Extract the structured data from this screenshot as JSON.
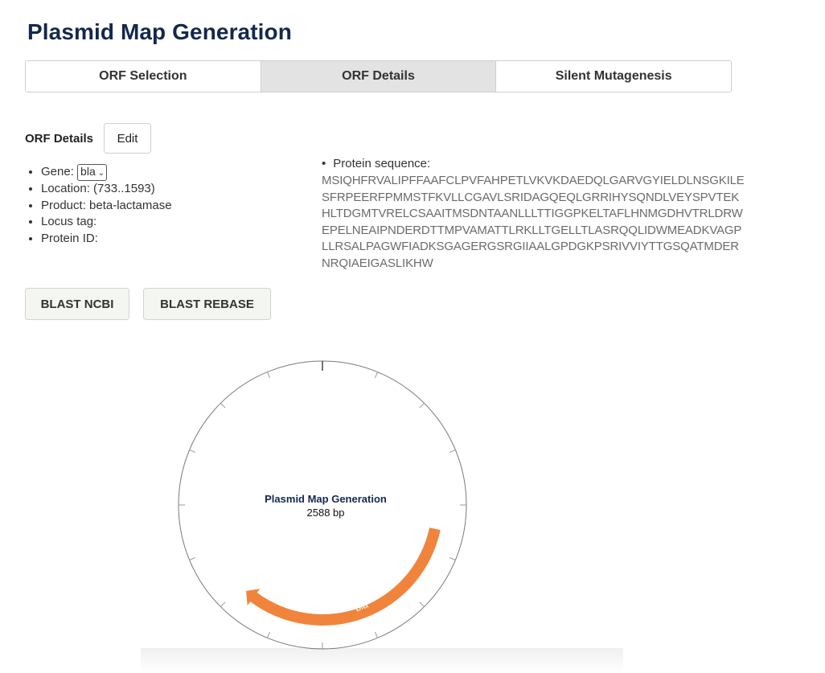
{
  "page": {
    "title": "Plasmid Map Generation"
  },
  "tabs": [
    {
      "label": "ORF Selection",
      "active": false
    },
    {
      "label": "ORF Details",
      "active": true
    },
    {
      "label": "Silent Mutagenesis",
      "active": false
    }
  ],
  "details": {
    "heading": "ORF Details",
    "edit_label": "Edit",
    "gene_label": "Gene:",
    "gene_value": "bla",
    "location": "Location: (733..1593)",
    "product": "Product: beta-lactamase",
    "locus_tag": "Locus tag:",
    "protein_id": "Protein ID:"
  },
  "protein": {
    "label": "Protein sequence:",
    "lines": [
      "MSIQHFRVALIPFFAAFCLPVFAHPETLVKVKDAEDQLGARVGYIELDLNSGKILE",
      "SFRPEERFPMMSTFKVLLCGAVLSRIDAGQEQLGRRIHYSQNDLVEYSPVTEK",
      "HLTDGMTVRELCSAAITMSDNTAANLLLTTIGGPKELTAFLHNMGDHVTRLDRW",
      "EPELNEAIPNDERDTTMPVAMATTLRKLLTGELLTLASRQQLIDWMEADKVAGP",
      "LLRSALPAGWFIADKSGAGERGSRGIIAALGPDGKPSRIVVIYTTGSQATMDER",
      "NRQIAEIGASLIKHW"
    ]
  },
  "buttons": {
    "blast_ncbi": "BLAST NCBI",
    "blast_rebase": "BLAST REBASE"
  },
  "plasmid_map": {
    "title": "Plasmid Map Generation",
    "length_label": "2588 bp",
    "total_bp": 2588,
    "feature": {
      "name": "bla",
      "start": 733,
      "end": 1593,
      "strand": "-",
      "color": "#f0843c"
    }
  },
  "colors": {
    "title": "#13284e",
    "tab_active_bg": "#e3e3e3",
    "sequence_text": "#6b6b6b",
    "feature": "#f0843c"
  }
}
